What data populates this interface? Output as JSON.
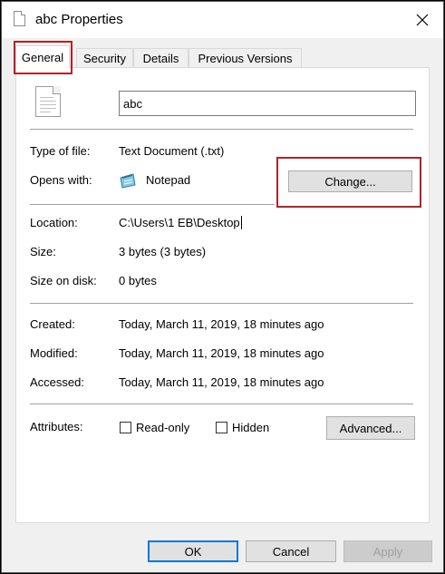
{
  "window": {
    "title": "abc Properties"
  },
  "tabs": [
    {
      "label": "General",
      "active": true
    },
    {
      "label": "Security",
      "active": false
    },
    {
      "label": "Details",
      "active": false
    },
    {
      "label": "Previous Versions",
      "active": false
    }
  ],
  "general": {
    "file_name": "abc",
    "type_label": "Type of file:",
    "type_value": "Text Document (.txt)",
    "opens_label": "Opens with:",
    "opens_value": "Notepad",
    "change_button": "Change...",
    "location_label": "Location:",
    "location_value": "C:\\Users\\1 EB\\Desktop",
    "size_label": "Size:",
    "size_value": "3 bytes (3 bytes)",
    "size_disk_label": "Size on disk:",
    "size_disk_value": "0 bytes",
    "created_label": "Created:",
    "created_value": "Today, March 11, 2019, 18 minutes ago",
    "modified_label": "Modified:",
    "modified_value": "Today, March 11, 2019, 18 minutes ago",
    "accessed_label": "Accessed:",
    "accessed_value": "Today, March 11, 2019, 18 minutes ago",
    "attributes_label": "Attributes:",
    "readonly_label": "Read-only",
    "readonly_checked": false,
    "hidden_label": "Hidden",
    "hidden_checked": false,
    "advanced_button": "Advanced..."
  },
  "footer": {
    "ok": "OK",
    "cancel": "Cancel",
    "apply": "Apply"
  },
  "icons": {
    "title": "text-file-icon",
    "file": "text-document-icon",
    "opens_with": "notepad-icon",
    "close": "close-icon"
  },
  "colors": {
    "highlight": "#b0232a",
    "focus": "#0078d7"
  }
}
